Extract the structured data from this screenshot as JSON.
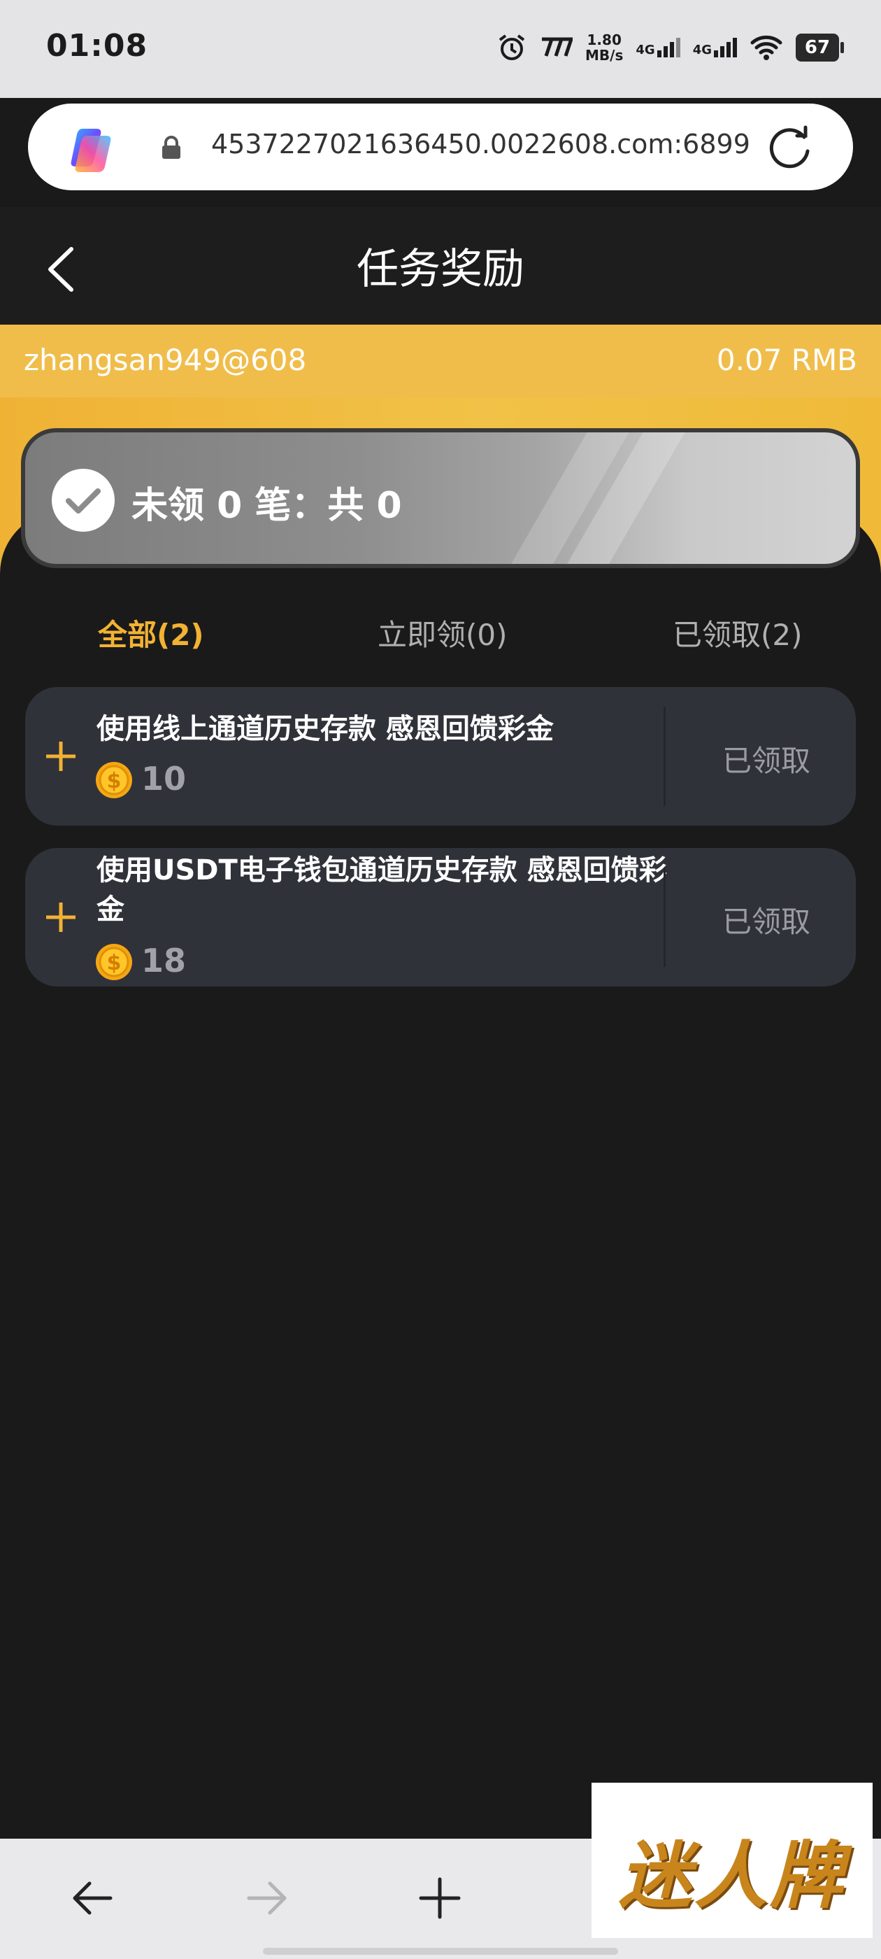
{
  "status_bar": {
    "time": "01:08",
    "speed_value": "1.80",
    "speed_unit": "MB/s",
    "net1": "4G",
    "net2": "4G",
    "battery": "67"
  },
  "browser": {
    "url": "4537227021636450.0022608.com:6899"
  },
  "header": {
    "title": "任务奖励"
  },
  "account": {
    "username": "zhangsan949@608",
    "balance": "0.07 RMB"
  },
  "summary": {
    "text": "未领 0 笔：共 0"
  },
  "tabs": [
    {
      "label": "全部(2)",
      "active": true
    },
    {
      "label": "立即领(0)",
      "active": false
    },
    {
      "label": "已领取(2)",
      "active": false
    }
  ],
  "tasks": [
    {
      "name": "使用线上通道历史存款 感恩回馈彩金",
      "amount": "10",
      "status": "已领取"
    },
    {
      "name": "使用USDT电子钱包通道历史存款 感恩回馈彩金",
      "amount": "18",
      "status": "已领取"
    }
  ],
  "watermark": {
    "text": "迷人牌"
  },
  "colors": {
    "accent": "#f2b233",
    "yellow_bar": "#f0bd4b",
    "page_bg": "#1a1a1a",
    "card_bg": "#30323a"
  },
  "icons": {
    "back": "chevron-left-icon",
    "reload": "reload-icon",
    "lock": "lock-icon",
    "check": "check-circle-icon",
    "plus": "plus-icon",
    "coin": "coin-icon",
    "nav_back": "arrow-left-icon",
    "nav_forward": "arrow-right-icon",
    "nav_new": "plus-icon"
  }
}
